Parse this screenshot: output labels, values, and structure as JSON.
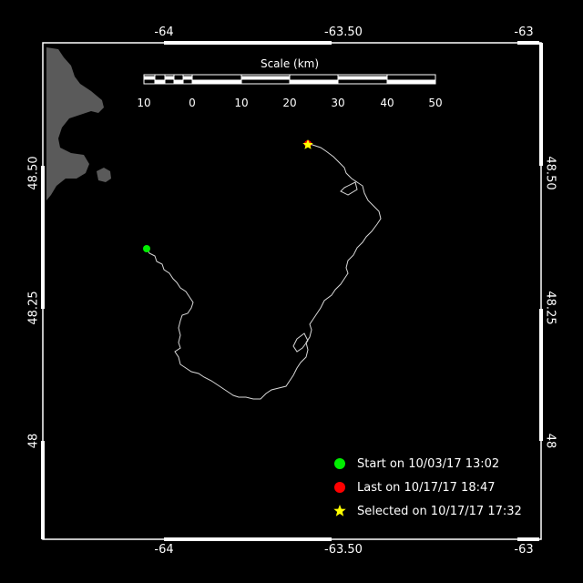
{
  "map": {
    "lon_ticks": [
      "-64",
      "-63.50",
      "-63"
    ],
    "lat_ticks": [
      "48.50",
      "48.25",
      "48"
    ],
    "scale": {
      "title": "Scale (km)",
      "labels": [
        "10",
        "0",
        "10",
        "20",
        "30",
        "40",
        "50"
      ]
    },
    "colors": {
      "background": "#000000",
      "land": "#5a5a5a",
      "track": "#d8d8d8",
      "start": "#00ee00",
      "last": "#ff0000",
      "selected": "#ffff00"
    }
  },
  "legend": {
    "items": [
      {
        "text": "Start on 10/03/17 13:02",
        "symbol": "green-dot"
      },
      {
        "text": "Last on 10/17/17 18:47",
        "symbol": "red-dot"
      },
      {
        "text": "Selected on 10/17/17 17:32",
        "symbol": "yellow-star"
      }
    ]
  }
}
